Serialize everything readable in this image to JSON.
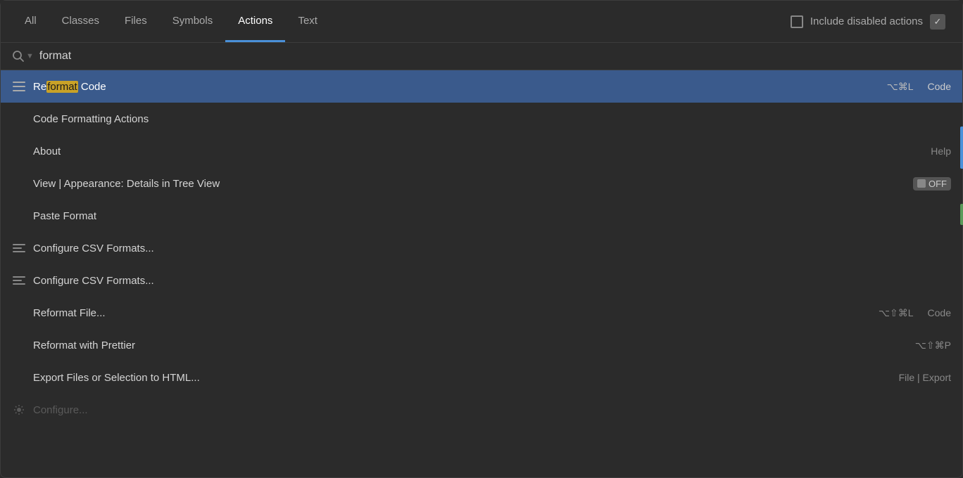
{
  "tabs": [
    {
      "id": "all",
      "label": "All",
      "active": false
    },
    {
      "id": "classes",
      "label": "Classes",
      "active": false
    },
    {
      "id": "files",
      "label": "Files",
      "active": false
    },
    {
      "id": "symbols",
      "label": "Symbols",
      "active": false
    },
    {
      "id": "actions",
      "label": "Actions",
      "active": true
    },
    {
      "id": "text",
      "label": "Text",
      "active": false
    }
  ],
  "include_disabled": {
    "label": "Include disabled actions",
    "checked": false
  },
  "search": {
    "placeholder": "format",
    "value": "format",
    "icon": "🔍"
  },
  "results": [
    {
      "id": "reformat-code",
      "icon": "menu",
      "text_before": "Re",
      "text_highlight": "format",
      "text_after": " Code",
      "shortcut": "⌥⌘L",
      "category": "Code",
      "selected": true,
      "has_icon": true
    },
    {
      "id": "code-formatting-actions",
      "icon": "",
      "text": "Code Formatting Actions",
      "shortcut": "",
      "category": "",
      "selected": false,
      "has_icon": false
    },
    {
      "id": "about",
      "icon": "",
      "text": "About",
      "shortcut": "",
      "category": "Help",
      "selected": false,
      "has_icon": false
    },
    {
      "id": "view-appearance",
      "icon": "",
      "text": "View | Appearance: Details in Tree View",
      "shortcut": "",
      "category": "toggle",
      "selected": false,
      "has_icon": false
    },
    {
      "id": "paste-format",
      "icon": "",
      "text": "Paste Format",
      "shortcut": "",
      "category": "",
      "selected": false,
      "has_icon": false
    },
    {
      "id": "configure-csv-1",
      "icon": "lines",
      "text": "Configure CSV Formats...",
      "shortcut": "",
      "category": "",
      "selected": false,
      "has_icon": true
    },
    {
      "id": "configure-csv-2",
      "icon": "lines",
      "text": "Configure CSV Formats...",
      "shortcut": "",
      "category": "",
      "selected": false,
      "has_icon": true
    },
    {
      "id": "reformat-file",
      "icon": "",
      "text": "Reformat File...",
      "shortcut": "⌥⇧⌘L",
      "category": "Code",
      "selected": false,
      "has_icon": false
    },
    {
      "id": "reformat-prettier",
      "icon": "",
      "text": "Reformat with Prettier",
      "shortcut": "⌥⇧⌘P",
      "category": "",
      "selected": false,
      "has_icon": false
    },
    {
      "id": "export-files-html",
      "icon": "",
      "text": "Export Files or Selection to HTML...",
      "shortcut": "",
      "category": "File | Export",
      "selected": false,
      "has_icon": false
    }
  ],
  "colors": {
    "active_tab_underline": "#4a90d9",
    "selected_row": "#3a5a8c",
    "highlight_bg": "#c9a227",
    "background": "#2b2b2b"
  }
}
